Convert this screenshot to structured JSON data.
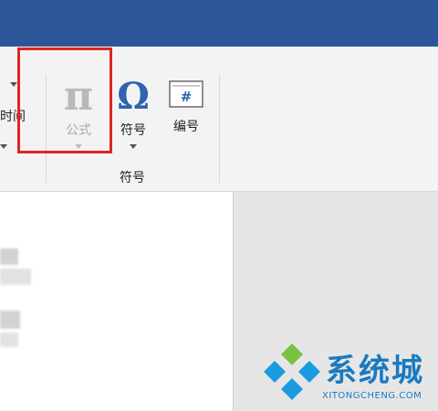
{
  "ribbon": {
    "partial_label": "时间",
    "group_label": "符号",
    "buttons": [
      {
        "id": "formula",
        "icon_glyph": "π",
        "icon_name": "pi-icon",
        "label": "公式",
        "state": "disabled",
        "highlighted": true
      },
      {
        "id": "symbol",
        "icon_glyph": "Ω",
        "icon_name": "omega-icon",
        "label": "符号",
        "state": "enabled"
      },
      {
        "id": "number",
        "icon_glyph": "#",
        "icon_name": "number-hash-icon",
        "label": "编号",
        "state": "enabled"
      }
    ]
  },
  "colors": {
    "titlebar": "#2b579a",
    "ribbon_bg": "#f3f3f3",
    "highlight_border": "#e02424",
    "omega_blue": "#2e64b0",
    "disabled_gray": "#b9b9b9",
    "side_pane": "#e6e6e6",
    "watermark_blue": "#1a7ac0"
  },
  "watermark": {
    "title": "系统城",
    "url": "XITONGCHENG.COM"
  }
}
